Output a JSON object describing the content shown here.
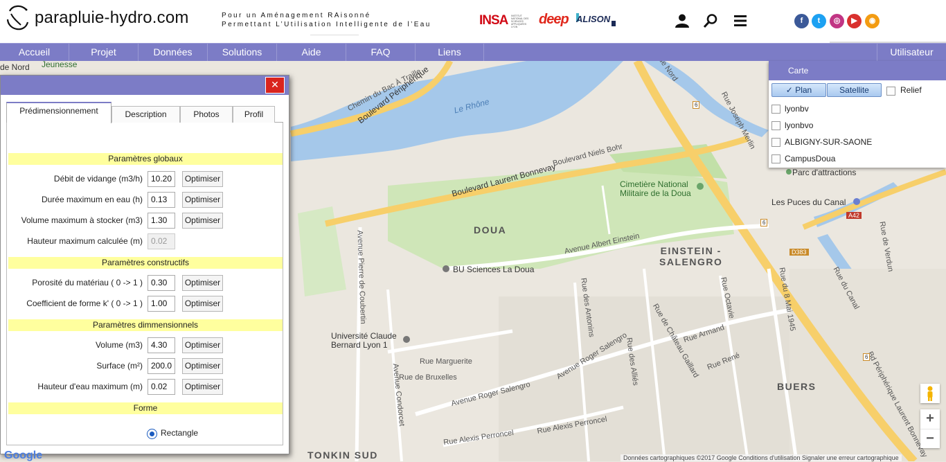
{
  "header": {
    "site_name": "parapluie-hydro.com",
    "tagline_line1": "Pour un Aménagement RAisonné",
    "tagline_line2": "Permettant L’Utilisation Intelligente de l’Eau",
    "partners": {
      "insa": "INSA",
      "insa_sub": "INSTITUT NATIONAL DES SCIENCES APPLIQUÉES LYON",
      "deep": "deep",
      "alison": "ALISON"
    },
    "icons": [
      "user-icon",
      "search-icon",
      "hamburger-menu-icon"
    ],
    "social": {
      "facebook": "f",
      "twitter": "t",
      "instagram": "◎",
      "youtube": "▶",
      "rss": "◉"
    }
  },
  "nav": {
    "items": [
      {
        "label": "Accueil"
      },
      {
        "label": "Projet"
      },
      {
        "label": "Données"
      },
      {
        "label": "Solutions"
      },
      {
        "label": "Aide"
      },
      {
        "label": "FAQ"
      },
      {
        "label": "Liens"
      }
    ],
    "user": "Utilisateur"
  },
  "layers": {
    "title": "Carte",
    "plan": "Plan",
    "plan_check": "✓",
    "satellite": "Satellite",
    "relief": "Relief",
    "items": [
      {
        "label": "lyonbv"
      },
      {
        "label": "lyonbvo"
      },
      {
        "label": "ALBIGNY-SUR-SAONE"
      },
      {
        "label": "CampusDoua"
      }
    ]
  },
  "dialog": {
    "close": "✕",
    "tabs": [
      {
        "label": "Prédimensionnement"
      },
      {
        "label": "Description"
      },
      {
        "label": "Photos"
      },
      {
        "label": "Profil"
      }
    ],
    "sections": {
      "global": "Paramètres globaux",
      "constructive": "Paramètres constructifs",
      "dimension": "Paramètres dimmensionnels",
      "shape": "Forme"
    },
    "optimize_label": "Optimiser",
    "params": [
      {
        "label": "Débit de vidange (m3/h)",
        "value": "10.20"
      },
      {
        "label": "Durée maximum en eau (h)",
        "value": "0.13"
      },
      {
        "label": "Volume maximum à stocker (m3)",
        "value": "1.30"
      },
      {
        "label": "Hauteur maximum calculée (m)",
        "value": "0.02"
      },
      {
        "label": "Porosité du matériau ( 0 -> 1 )",
        "value": "0.30"
      },
      {
        "label": "Coefficient de forme k' ( 0 -> 1 )",
        "value": "1.00"
      },
      {
        "label": "Volume (m3)",
        "value": "4.30"
      },
      {
        "label": "Surface (m²)",
        "value": "200.0"
      },
      {
        "label": "Hauteur d'eau maximum (m)",
        "value": "0.02"
      }
    ],
    "shape_option": "Rectangle"
  },
  "map": {
    "labels": {
      "rhone": "Le Rhône",
      "bd_peripherique": "Boulevard Périphérique",
      "bonnevay": "Boulevard Laurent Bonnevay",
      "niels_bohr": "Boulevard Niels Bohr",
      "cimetiere": "Cimetière National\nMilitaire de la Doua",
      "doua": "DOUA",
      "bu": "BU Sciences La Doua",
      "einstein_av": "Avenue Albert Einstein",
      "einstein_salengro": "EINSTEIN -\nSALENGRO",
      "pierre_coubertin": "Avenue Pierre de Coubertin",
      "ucbl": "Université Claude\nBernard Lyon 1",
      "marguerite": "Rue Marguerite",
      "bruxelles": "Rue de Bruxelles",
      "condorcet": "Avenue Condorcet",
      "salengro1": "Avenue Roger Salengro",
      "salengro2": "Avenue Roger Salengro",
      "antonins": "Rue des Antonins",
      "allies": "Rue des Alliés",
      "chateau_gaillard": "Rue de Château Gaillard",
      "octavie": "Rue Octavie",
      "armand": "Rue Armand",
      "rene": "Rue René",
      "huit_mai": "Rue du 8 Mai 1945",
      "buers": "BUERS",
      "perroncel1": "Rue Alexis Perroncel",
      "perroncel2": "Rue Alexis Perroncel",
      "tonkin": "TONKIN SUD",
      "puces": "Les Puces du Canal",
      "parc": "Parc d'attractions",
      "canal": "Rue du Canal",
      "verdun": "Rue de Verdun",
      "joseph_merlin": "Rue Joseph Merlin",
      "bd_per_laurent": "Bd Périphérique Laurent Bonnevay",
      "chemin_bac": "Chemin du Bac À Traille",
      "ue_nord": "ue Nord",
      "jeunesse": "Jeunesse",
      "de_nord": "de Nord",
      "a42": "A42",
      "d383": "D383",
      "marker6a": "6",
      "marker6b": "6",
      "marker6c": "6"
    },
    "zoom_in": "+",
    "zoom_out": "−",
    "attribution": "Données cartographiques ©2017 Google    Conditions d'utilisation    Signaler une erreur cartographique",
    "google": "Google"
  }
}
